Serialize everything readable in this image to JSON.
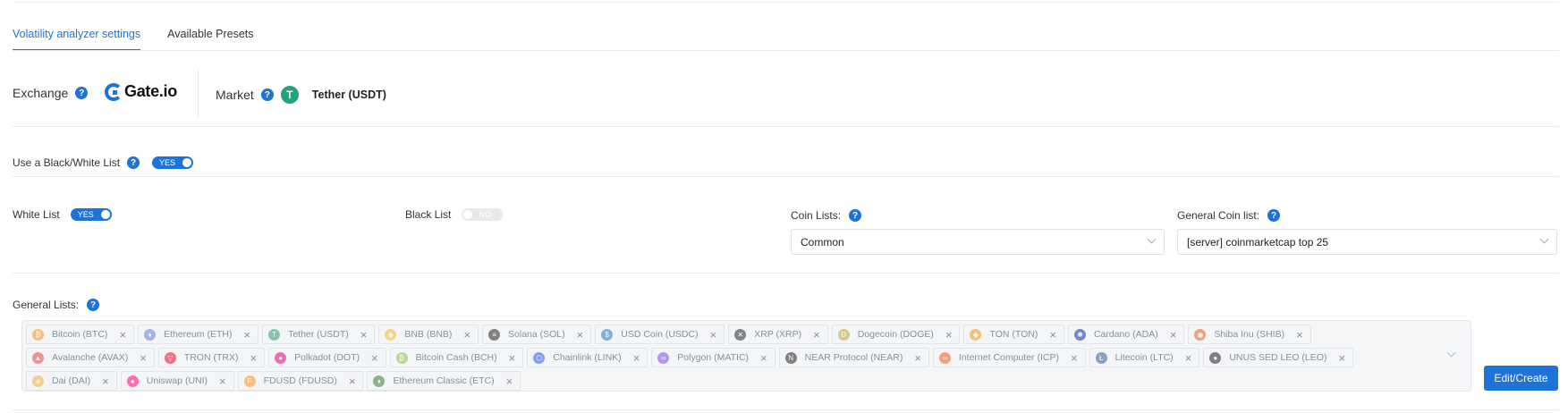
{
  "tabs": [
    {
      "label": "Volatility analyzer settings",
      "active": true
    },
    {
      "label": "Available Presets",
      "active": false
    }
  ],
  "exchange": {
    "label": "Exchange",
    "logo_text": "Gate.io"
  },
  "market": {
    "label": "Market",
    "icon": "T",
    "value": "Tether (USDT)"
  },
  "bw_list": {
    "label": "Use a Black/White List",
    "toggle": "YES"
  },
  "white_list": {
    "label": "White List",
    "toggle": "YES"
  },
  "black_list": {
    "label": "Black List",
    "toggle": "NO"
  },
  "coin_lists": {
    "label": "Coin Lists:",
    "value": "Common"
  },
  "general_coin_list": {
    "label": "General Coin list:",
    "value": "[server] coinmarketcap top 25"
  },
  "general_lists": {
    "label": "General Lists:"
  },
  "chips": [
    {
      "label": "Bitcoin (BTC)",
      "color": "#f7931a",
      "glyph": "₿"
    },
    {
      "label": "Ethereum (ETH)",
      "color": "#627eea",
      "glyph": "♦"
    },
    {
      "label": "Tether (USDT)",
      "color": "#26a17b",
      "glyph": "T"
    },
    {
      "label": "BNB (BNB)",
      "color": "#f3ba2f",
      "glyph": "◆"
    },
    {
      "label": "Solana (SOL)",
      "color": "#222222",
      "glyph": "≡"
    },
    {
      "label": "USD Coin (USDC)",
      "color": "#2775ca",
      "glyph": "$"
    },
    {
      "label": "XRP (XRP)",
      "color": "#23292f",
      "glyph": "✕"
    },
    {
      "label": "Dogecoin (DOGE)",
      "color": "#c2a633",
      "glyph": "D"
    },
    {
      "label": "TON (TON)",
      "color": "#f7931a",
      "glyph": "◆"
    },
    {
      "label": "Cardano (ADA)",
      "color": "#0033ad",
      "glyph": "✺"
    },
    {
      "label": "Shiba Inu (SHIB)",
      "color": "#e0601e",
      "glyph": "◉"
    },
    {
      "label": "Avalanche (AVAX)",
      "color": "#e84142",
      "glyph": "▲"
    },
    {
      "label": "TRON (TRX)",
      "color": "#ef0027",
      "glyph": "▽"
    },
    {
      "label": "Polkadot (DOT)",
      "color": "#e6007a",
      "glyph": "●"
    },
    {
      "label": "Bitcoin Cash (BCH)",
      "color": "#8dc351",
      "glyph": "₿"
    },
    {
      "label": "Chainlink (LINK)",
      "color": "#2a5ada",
      "glyph": "⬡"
    },
    {
      "label": "Polygon (MATIC)",
      "color": "#8247e5",
      "glyph": "∞"
    },
    {
      "label": "NEAR Protocol (NEAR)",
      "color": "#222222",
      "glyph": "N"
    },
    {
      "label": "Internet Computer (ICP)",
      "color": "#f15a24",
      "glyph": "∞"
    },
    {
      "label": "Litecoin (LTC)",
      "color": "#345d9d",
      "glyph": "Ł"
    },
    {
      "label": "UNUS SED LEO (LEO)",
      "color": "#222222",
      "glyph": "●"
    },
    {
      "label": "Dai (DAI)",
      "color": "#f5ac37",
      "glyph": "◈"
    },
    {
      "label": "Uniswap (UNI)",
      "color": "#ff007a",
      "glyph": "♠"
    },
    {
      "label": "FDUSD (FDUSD)",
      "color": "#f7931a",
      "glyph": "F"
    },
    {
      "label": "Ethereum Classic (ETC)",
      "color": "#328332",
      "glyph": "♦"
    }
  ],
  "edit_button": "Edit/Create",
  "help_glyph": "?"
}
